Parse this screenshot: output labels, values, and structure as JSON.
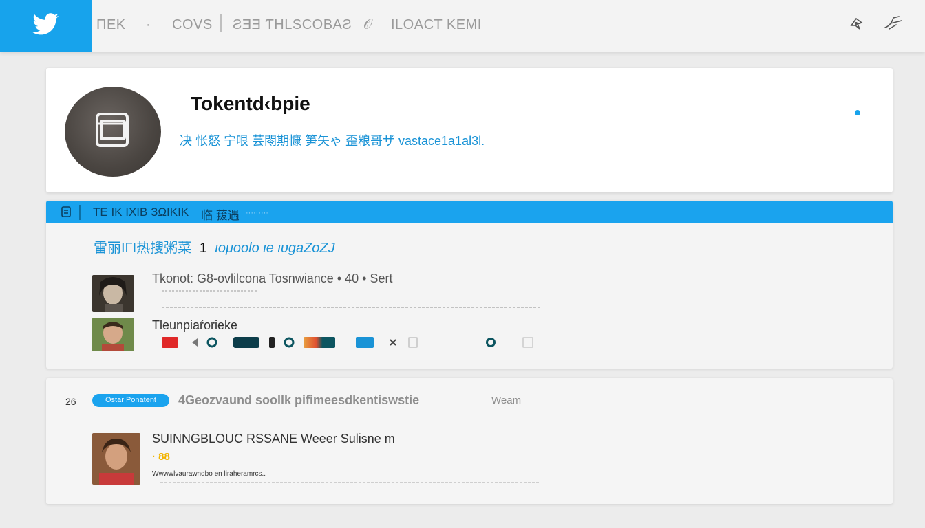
{
  "topbar": {
    "nav": [
      "ΠΕΚ",
      "·",
      "COVS",
      "ƧƎƎ ƬΗLSCOBAƧ",
      "𝒪",
      "ILOACT ΚΕΜΙ"
    ],
    "icons": [
      "twitter-bird-icon",
      "notifications-icon",
      "compose-icon"
    ]
  },
  "profile": {
    "name": "Tokentd‹bpie",
    "bio": "决  怅怒 宁哏 芸閝期慷 笋矢ゃ 歪粮哥ザ vastace1a1al3l."
  },
  "feed": {
    "header_label_1": "ΤΕ ΙΚ ΙΧΙΒ ЗΩΙΚΙΚ",
    "header_label_2": "临 菝遇",
    "header_label_3": "·········",
    "trend_prefix": "雷丽ΙΓΙ热搜粥菜",
    "trend_num": "1",
    "trend_text": "ιομοοlο ιe ιυgaΖοΖJ",
    "tweets": [
      {
        "title": "Tkonot: G8-ovlilcona  Tosnwiance  • 40 • Sert"
      },
      {
        "name": "Tleunpiaŕoriеke"
      }
    ]
  },
  "trending": {
    "rank": "26",
    "pill": "Ostar Ponatent",
    "title": "4Geozvaund soollk pifimeesdkentiswstie",
    "meta": "Weam",
    "post_title": "SUINNGBLOUC RSSANE  Weeer  Sulisne  m",
    "post_badge": "· 88",
    "post_handle": "Wwwwlvaurawndbo en liraheramrcs.."
  },
  "colors": {
    "brand": "#17a3ec",
    "bio": "#1a93d6",
    "badge": "#f2b400"
  }
}
